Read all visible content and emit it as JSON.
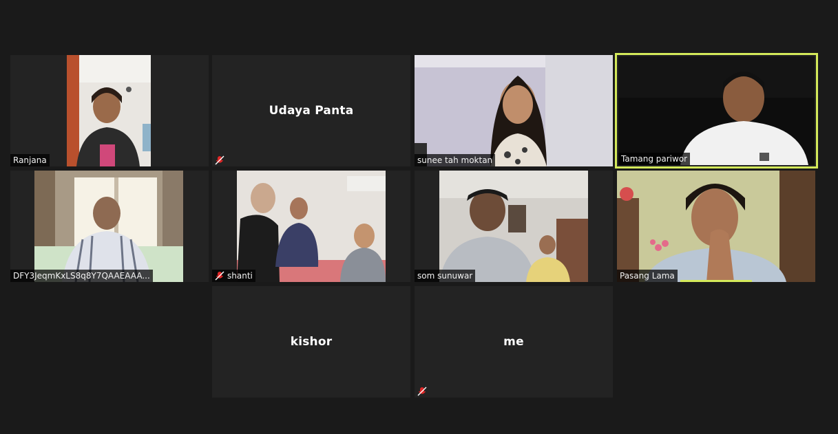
{
  "meeting": {
    "participants": [
      {
        "name": "Ranjana",
        "video_on": true,
        "muted": false
      },
      {
        "name": "Udaya Panta",
        "video_on": false,
        "muted": true
      },
      {
        "name": "sunee tah moktan",
        "video_on": true,
        "muted": false
      },
      {
        "name": "Tamang pariwor",
        "video_on": true,
        "muted": false,
        "active_speaker": true
      },
      {
        "name": "DFY3JeqmKxLS8q8Y7QAAEAAA...",
        "video_on": true,
        "muted": false
      },
      {
        "name": "shanti",
        "video_on": true,
        "muted": true
      },
      {
        "name": "som sunuwar",
        "video_on": true,
        "muted": false
      },
      {
        "name": "Pasang Lama",
        "video_on": true,
        "muted": false,
        "speaking": true
      },
      {
        "name": "kishor",
        "video_on": false,
        "muted": false
      },
      {
        "name": "me",
        "video_on": false,
        "muted": true
      }
    ]
  },
  "colors": {
    "background": "#1a1a1a",
    "tile": "#232323",
    "active_speaker_border": "#d4ea5a",
    "muted_icon": "#e02828"
  }
}
